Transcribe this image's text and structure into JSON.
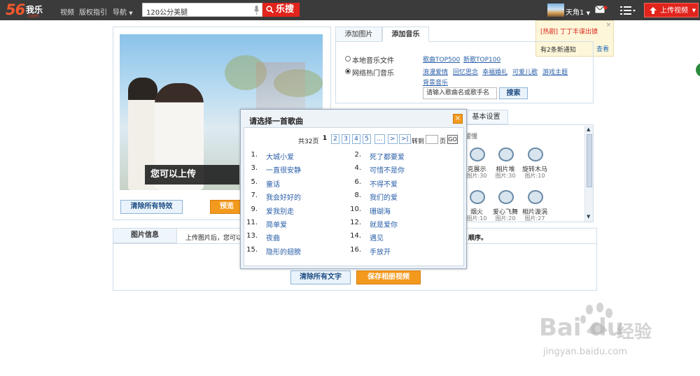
{
  "header": {
    "logo_num": "56",
    "logo_cn": "我乐",
    "logo_com": ".com",
    "nav": [
      "视频",
      "版权指引",
      "导航"
    ],
    "search_value": "120公分美腿",
    "search_button": "乐搜",
    "username": "天角1",
    "upload_button": "上传视频"
  },
  "notice": {
    "hot_text": "[热剧] 丁丁丰谍出镜",
    "close": "×",
    "sub_text": "有2条新通知",
    "view": "查看"
  },
  "editor": {
    "caption": "您可以上传",
    "clear_effects": "清除所有特效",
    "preview": "预览"
  },
  "music": {
    "tabs": [
      "添加图片",
      "添加音乐"
    ],
    "radio_local": "本地音乐文件",
    "radio_online": "网络热门音乐",
    "links": [
      "歌曲TOP500",
      "新歌TOP100",
      "浪漫爱情",
      "回忆思念",
      "幸福婚礼",
      "可爱儿歌",
      "游戏主题",
      "背景音乐"
    ],
    "song_input_placeholder": "请输入歌曲名或歌手名",
    "search_button": "搜索"
  },
  "effects": {
    "basic_tab": "基本设置",
    "hint": "缓慢",
    "items": [
      {
        "name": "克展示",
        "count": "图片:30"
      },
      {
        "name": "相片堆",
        "count": "图片:30"
      },
      {
        "name": "旋转木马",
        "count": "图片:10"
      },
      {
        "name": "烟火",
        "count": "图片:10"
      },
      {
        "name": "爱心飞舞",
        "count": "图片:20"
      },
      {
        "name": "相片漩涡",
        "count": "图片:27"
      }
    ]
  },
  "info": {
    "tab": "图片信息",
    "text": "上传图片后，您可以",
    "text_end": "顺序。",
    "clear_text": "清除所有文字",
    "save": "保存相册视频"
  },
  "dialog": {
    "title": "请选择一首歌曲",
    "close": "×",
    "total": "共32页",
    "pages": [
      "1",
      "2",
      "3",
      "4",
      "5",
      "...",
      ">",
      ">|"
    ],
    "goto": "转到",
    "page_unit": "页",
    "go": "GO",
    "songs": [
      {
        "no": "1.",
        "name": "大城小爱"
      },
      {
        "no": "2.",
        "name": "死了都要爱"
      },
      {
        "no": "3.",
        "name": "一直很安静"
      },
      {
        "no": "4.",
        "name": "可惜不是你"
      },
      {
        "no": "5.",
        "name": "童话"
      },
      {
        "no": "6.",
        "name": "不得不爱"
      },
      {
        "no": "7.",
        "name": "我会好好的"
      },
      {
        "no": "8.",
        "name": "我们的爱"
      },
      {
        "no": "9.",
        "name": "爱我别走"
      },
      {
        "no": "10.",
        "name": "珊瑚海"
      },
      {
        "no": "11.",
        "name": "简单爱"
      },
      {
        "no": "12.",
        "name": "就是爱你"
      },
      {
        "no": "13.",
        "name": "夜曲"
      },
      {
        "no": "14.",
        "name": "遇见"
      },
      {
        "no": "15.",
        "name": "隐形的翅膀"
      },
      {
        "no": "16.",
        "name": "手放开"
      }
    ]
  },
  "watermark": {
    "text": "Bai du",
    "text2": "经验",
    "url": "jingyan.baidu.com"
  },
  "colors": {
    "topbar": "#3b3b3b",
    "accent_red": "#e1241c",
    "accent_orange": "#f39a1e",
    "link_blue": "#2a5fa8"
  }
}
